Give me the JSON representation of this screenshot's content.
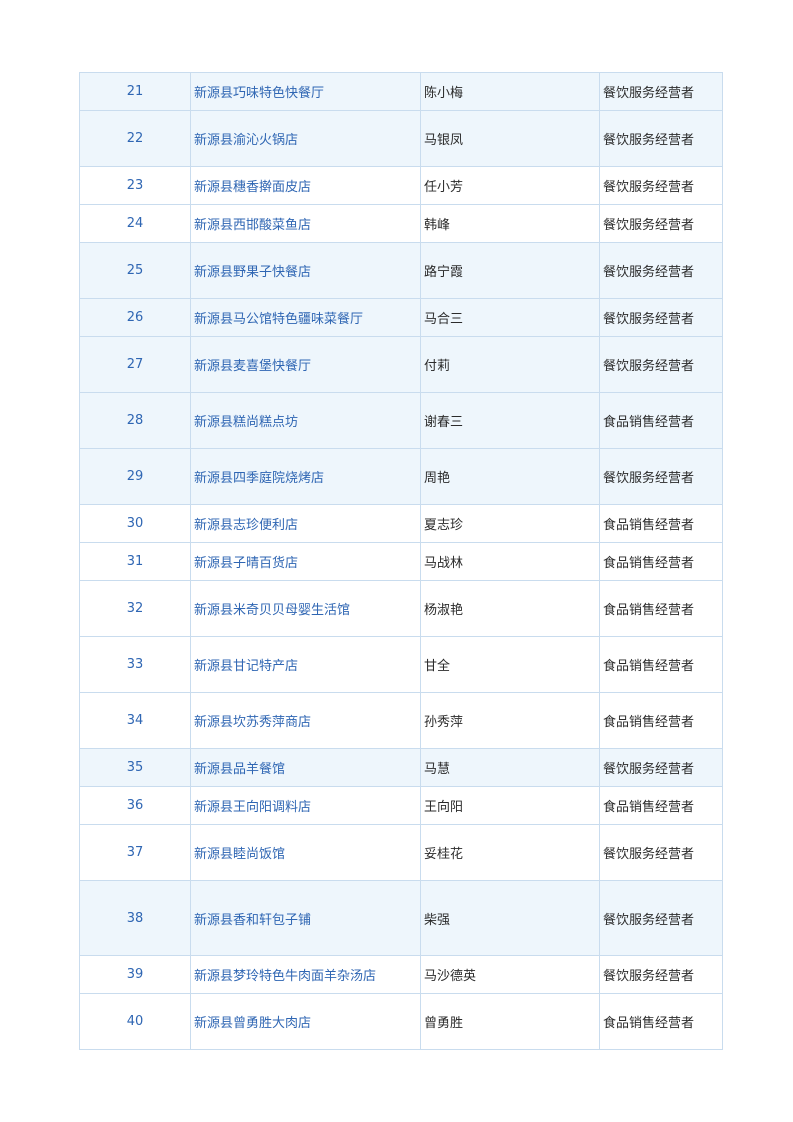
{
  "table": {
    "rows": [
      {
        "no": "21",
        "name": "新源县巧味特色快餐厅",
        "person": "陈小梅",
        "type": "餐饮服务经营者"
      },
      {
        "no": "22",
        "name": "新源县渝沁火锅店",
        "person": "马银凤",
        "type": "餐饮服务经营者"
      },
      {
        "no": "23",
        "name": "新源县穗香擀面皮店",
        "person": "任小芳",
        "type": "餐饮服务经营者"
      },
      {
        "no": "24",
        "name": "新源县西邯酸菜鱼店",
        "person": "韩峰",
        "type": "餐饮服务经营者"
      },
      {
        "no": "25",
        "name": "新源县野果子快餐店",
        "person": "路宁霞",
        "type": "餐饮服务经营者"
      },
      {
        "no": "26",
        "name": "新源县马公馆特色疆味菜餐厅",
        "person": "马合三",
        "type": "餐饮服务经营者"
      },
      {
        "no": "27",
        "name": "新源县麦喜堡快餐厅",
        "person": "付莉",
        "type": "餐饮服务经营者"
      },
      {
        "no": "28",
        "name": "新源县糕尚糕点坊",
        "person": "谢春三",
        "type": "食品销售经营者"
      },
      {
        "no": "29",
        "name": "新源县四季庭院烧烤店",
        "person": "周艳",
        "type": "餐饮服务经营者"
      },
      {
        "no": "30",
        "name": "新源县志珍便利店",
        "person": "夏志珍",
        "type": "食品销售经营者"
      },
      {
        "no": "31",
        "name": "新源县子晴百货店",
        "person": "马战林",
        "type": "食品销售经营者"
      },
      {
        "no": "32",
        "name": "新源县米奇贝贝母婴生活馆",
        "person": "杨淑艳",
        "type": "食品销售经营者"
      },
      {
        "no": "33",
        "name": "新源县甘记特产店",
        "person": "甘全",
        "type": "食品销售经营者"
      },
      {
        "no": "34",
        "name": "新源县坎苏秀萍商店",
        "person": "孙秀萍",
        "type": "食品销售经营者"
      },
      {
        "no": "35",
        "name": "新源县品羊餐馆",
        "person": "马慧",
        "type": "餐饮服务经营者"
      },
      {
        "no": "36",
        "name": "新源县王向阳调料店",
        "person": "王向阳",
        "type": "食品销售经营者"
      },
      {
        "no": "37",
        "name": "新源县睦尚饭馆",
        "person": "妥桂花",
        "type": "餐饮服务经营者"
      },
      {
        "no": "38",
        "name": "新源县香和轩包子铺",
        "person": "柴强",
        "type": "餐饮服务经营者"
      },
      {
        "no": "39",
        "name": "新源县梦玲特色牛肉面羊杂汤店",
        "person": "马沙德英",
        "type": "餐饮服务经营者"
      },
      {
        "no": "40",
        "name": "新源县曾勇胜大肉店",
        "person": "曾勇胜",
        "type": "食品销售经营者"
      }
    ]
  }
}
